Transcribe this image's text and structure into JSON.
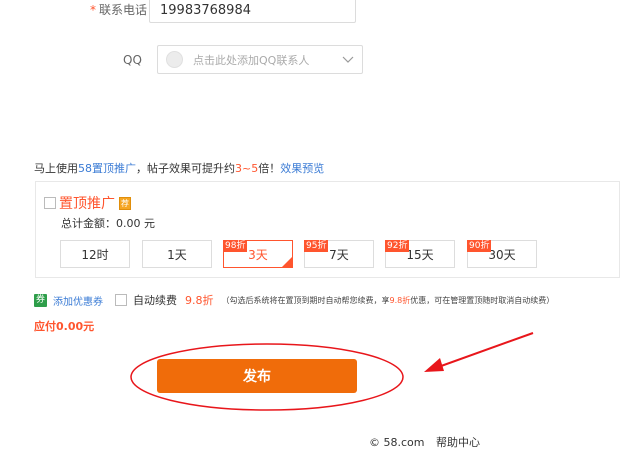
{
  "contact": {
    "required_mark": "*",
    "phone_label": "联系电话",
    "phone_value": "19983768984",
    "qq_label": "QQ",
    "qq_placeholder": "点击此处添加QQ联系人"
  },
  "promo": {
    "intro_prefix": "马上使用",
    "intro_link": "58置顶推广",
    "intro_mid": "，帖子效果可提升约",
    "intro_range": "3~5",
    "intro_suffix": "倍！",
    "preview_link": "效果预览",
    "option_title": "置顶推广",
    "badge": "荐",
    "total_label": "总计金额：",
    "total_value": "0.00",
    "total_unit": "元",
    "durations": [
      {
        "label": "12时",
        "discount": "",
        "selected": false
      },
      {
        "label": "1天",
        "discount": "",
        "selected": false
      },
      {
        "label": "3天",
        "discount": "98折",
        "selected": true
      },
      {
        "label": "7天",
        "discount": "95折",
        "selected": false
      },
      {
        "label": "15天",
        "discount": "92折",
        "selected": false
      },
      {
        "label": "30天",
        "discount": "90折",
        "selected": false
      }
    ]
  },
  "coupon": {
    "icon_char": "券",
    "link": "添加优惠券"
  },
  "auto_renew": {
    "label": "自动续费",
    "discount": "9.8折",
    "note_prefix": "（勾选后系统将在置顶到期时自动帮您续费，享",
    "note_discount": "9.8折",
    "note_suffix": "优惠，可在管理置顶随时取消自动续费）"
  },
  "payment": {
    "label": "应付0.00元"
  },
  "publish_label": "发布",
  "footer": {
    "copyright": "© 58.com",
    "help": "帮助中心"
  },
  "colors": {
    "accent": "#ff552e",
    "button": "#f06c0a",
    "link": "#3a7bd5",
    "annotation": "#e8161b"
  }
}
